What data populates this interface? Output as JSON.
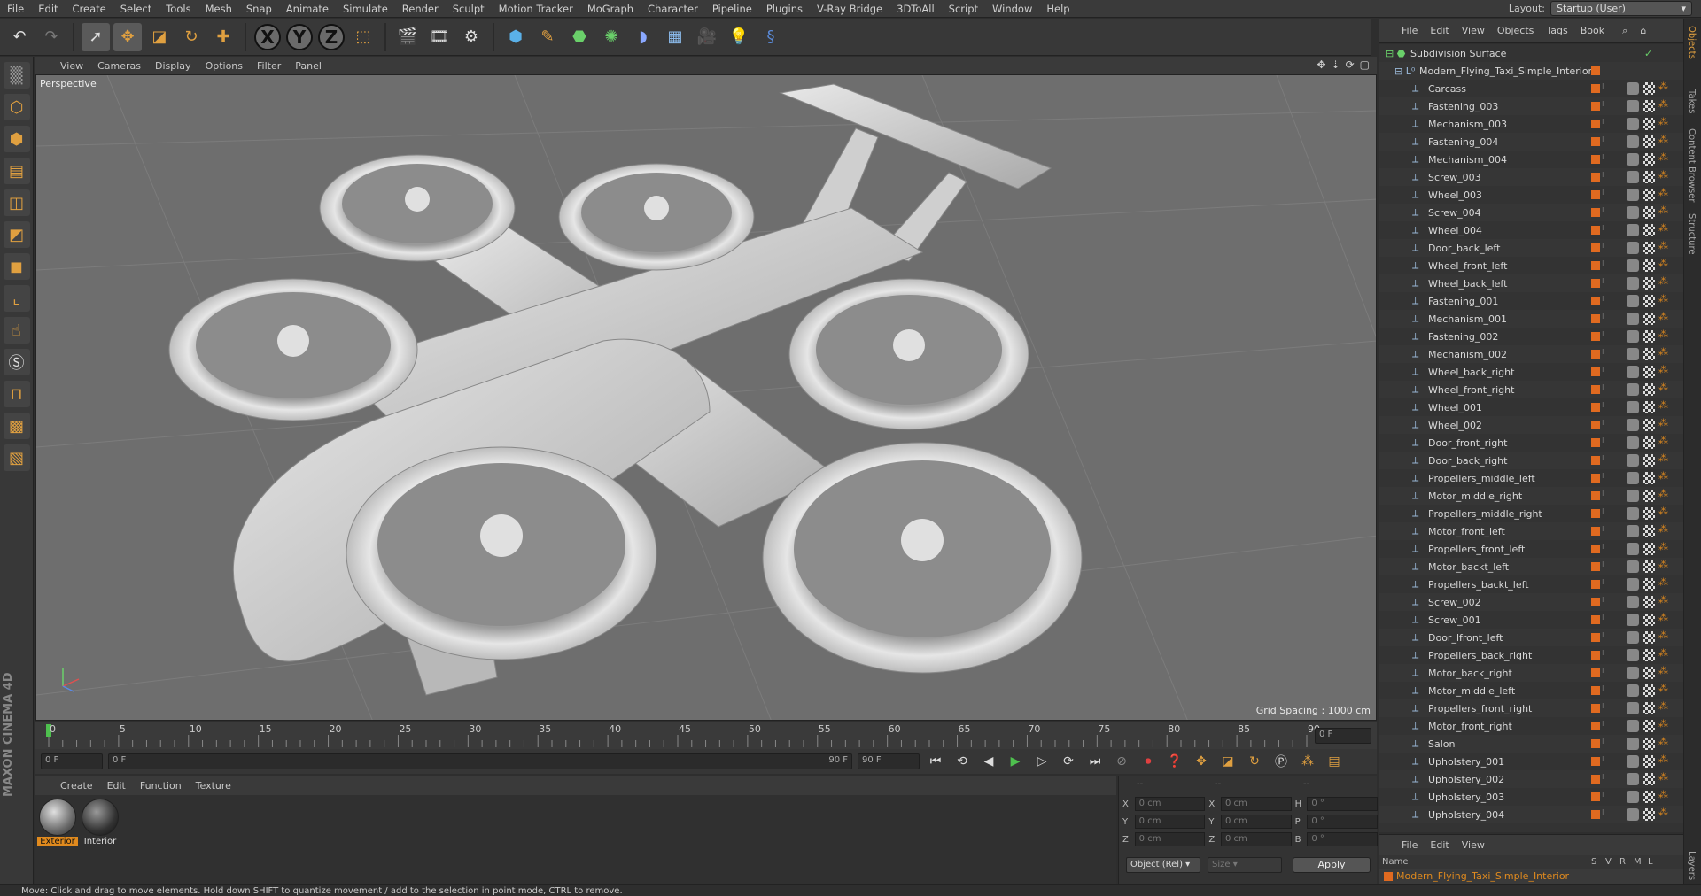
{
  "menubar": {
    "items": [
      "File",
      "Edit",
      "Create",
      "Select",
      "Tools",
      "Mesh",
      "Snap",
      "Animate",
      "Simulate",
      "Render",
      "Sculpt",
      "Motion Tracker",
      "MoGraph",
      "Character",
      "Pipeline",
      "Plugins",
      "V-Ray Bridge",
      "3DToAll",
      "Script",
      "Window",
      "Help"
    ],
    "layout_label": "Layout:",
    "layout_value": "Startup (User)"
  },
  "toolbar": {
    "axes": [
      "X",
      "Y",
      "Z"
    ]
  },
  "viewport": {
    "menu": [
      "View",
      "Cameras",
      "Display",
      "Options",
      "Filter",
      "Panel"
    ],
    "label": "Perspective",
    "grid_spacing": "Grid Spacing : 1000 cm"
  },
  "timeline": {
    "ticks": [
      "0",
      "5",
      "10",
      "15",
      "20",
      "25",
      "30",
      "35",
      "40",
      "45",
      "50",
      "55",
      "60",
      "65",
      "70",
      "75",
      "80",
      "85",
      "90"
    ],
    "current_frame_right": "0 F",
    "start_field": "0 F",
    "scrub_start": "0 F",
    "scrub_end": "90 F",
    "end_field": "90 F"
  },
  "materials": {
    "menu": [
      "Create",
      "Edit",
      "Function",
      "Texture"
    ],
    "items": [
      {
        "label": "Exterior",
        "selected": true
      },
      {
        "label": "Interior",
        "selected": false
      }
    ]
  },
  "coords": {
    "header": [
      "--",
      "--",
      "--"
    ],
    "rows": [
      {
        "a": "X",
        "av": "0 cm",
        "b": "X",
        "bv": "0 cm",
        "c": "H",
        "cv": "0 °"
      },
      {
        "a": "Y",
        "av": "0 cm",
        "b": "Y",
        "bv": "0 cm",
        "c": "P",
        "cv": "0 °"
      },
      {
        "a": "Z",
        "av": "0 cm",
        "b": "Z",
        "bv": "0 cm",
        "c": "B",
        "cv": "0 °"
      }
    ],
    "mode": "Object (Rel)",
    "size": "Size",
    "apply": "Apply"
  },
  "status": "Move: Click and drag to move elements. Hold down SHIFT to quantize movement / add to the selection in point mode, CTRL to remove.",
  "object_manager": {
    "menu": [
      "File",
      "Edit",
      "View",
      "Objects",
      "Tags",
      "Book"
    ],
    "root": "Subdivision Surface",
    "group": "Modern_Flying_Taxi_Simple_Interior",
    "objects": [
      "Carcass",
      "Fastening_003",
      "Mechanism_003",
      "Fastening_004",
      "Mechanism_004",
      "Screw_003",
      "Wheel_003",
      "Screw_004",
      "Wheel_004",
      "Door_back_left",
      "Wheel_front_left",
      "Wheel_back_left",
      "Fastening_001",
      "Mechanism_001",
      "Fastening_002",
      "Mechanism_002",
      "Wheel_back_right",
      "Wheel_front_right",
      "Wheel_001",
      "Wheel_002",
      "Door_front_right",
      "Door_back_right",
      "Propellers_middle_left",
      "Motor_middle_right",
      "Propellers_middle_right",
      "Motor_front_left",
      "Propellers_front_left",
      "Motor_backt_left",
      "Propellers_backt_left",
      "Screw_002",
      "Screw_001",
      "Door_lfront_left",
      "Propellers_back_right",
      "Motor_back_right",
      "Motor_middle_left",
      "Propellers_front_right",
      "Motor_front_right",
      "Salon",
      "Upholstery_001",
      "Upholstery_002",
      "Upholstery_003",
      "Upholstery_004"
    ]
  },
  "side_tabs": [
    "Objects",
    "Takes",
    "Content Browser",
    "Structure",
    "Layers"
  ],
  "layer_manager": {
    "menu": [
      "File",
      "Edit",
      "View"
    ],
    "header_name": "Name",
    "header_cols": [
      "S",
      "V",
      "R",
      "M",
      "L"
    ],
    "row": "Modern_Flying_Taxi_Simple_Interior"
  },
  "colors": {
    "accent": "#e08a1e",
    "viewport_bg": "#6e6e6e",
    "panel": "#333333"
  }
}
